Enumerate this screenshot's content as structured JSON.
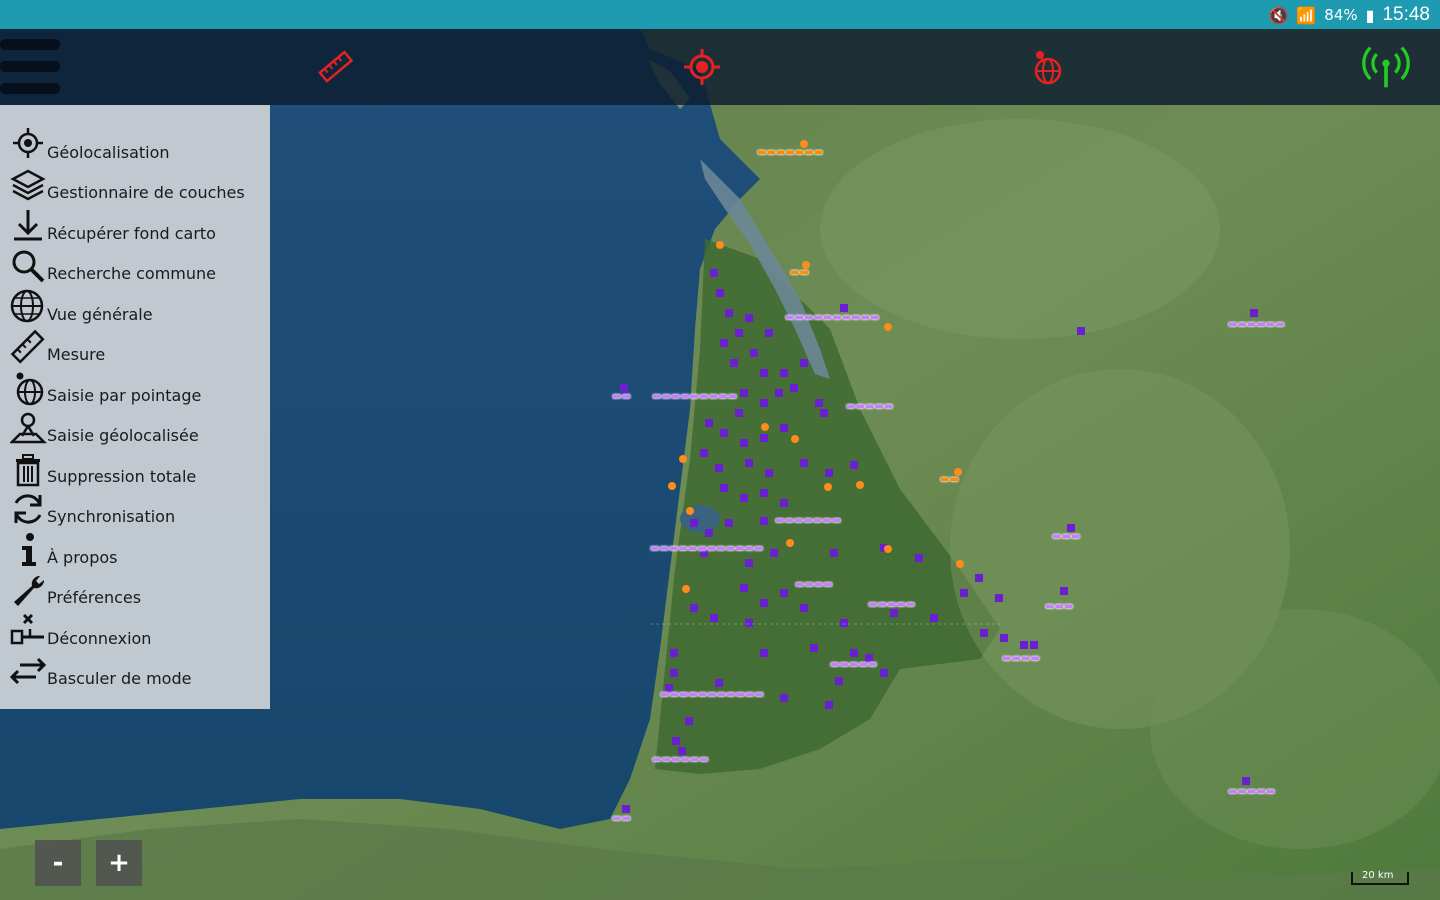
{
  "status": {
    "battery": "84%",
    "time": "15:48"
  },
  "menu": {
    "items": [
      {
        "label": "Géolocalisation",
        "icon": "geolocation-icon"
      },
      {
        "label": "Gestionnaire de couches",
        "icon": "layers-icon"
      },
      {
        "label": "Récupérer fond carto",
        "icon": "download-icon"
      },
      {
        "label": "Recherche commune",
        "icon": "search-icon"
      },
      {
        "label": "Vue générale",
        "icon": "globe-icon"
      },
      {
        "label": "Mesure",
        "icon": "ruler-icon"
      },
      {
        "label": "Saisie par pointage",
        "icon": "point-entry-icon"
      },
      {
        "label": "Saisie géolocalisée",
        "icon": "geolocated-entry-icon"
      },
      {
        "label": "Suppression totale",
        "icon": "trash-icon"
      },
      {
        "label": "Synchronisation",
        "icon": "sync-icon"
      },
      {
        "label": "À propos",
        "icon": "info-icon"
      },
      {
        "label": "Préférences",
        "icon": "wrench-icon"
      },
      {
        "label": "Déconnexion",
        "icon": "disconnect-icon"
      },
      {
        "label": "Basculer de mode",
        "icon": "swap-icon"
      }
    ]
  },
  "zoom": {
    "minus": "-",
    "plus": "+"
  },
  "scale": "20 km",
  "colors": {
    "status_bar": "#1e9bb0",
    "toolbar_icon_red": "#e52222",
    "signal_green": "#22cc22",
    "point_purple": "#6a1fd0",
    "point_orange": "#ff8c1a"
  }
}
